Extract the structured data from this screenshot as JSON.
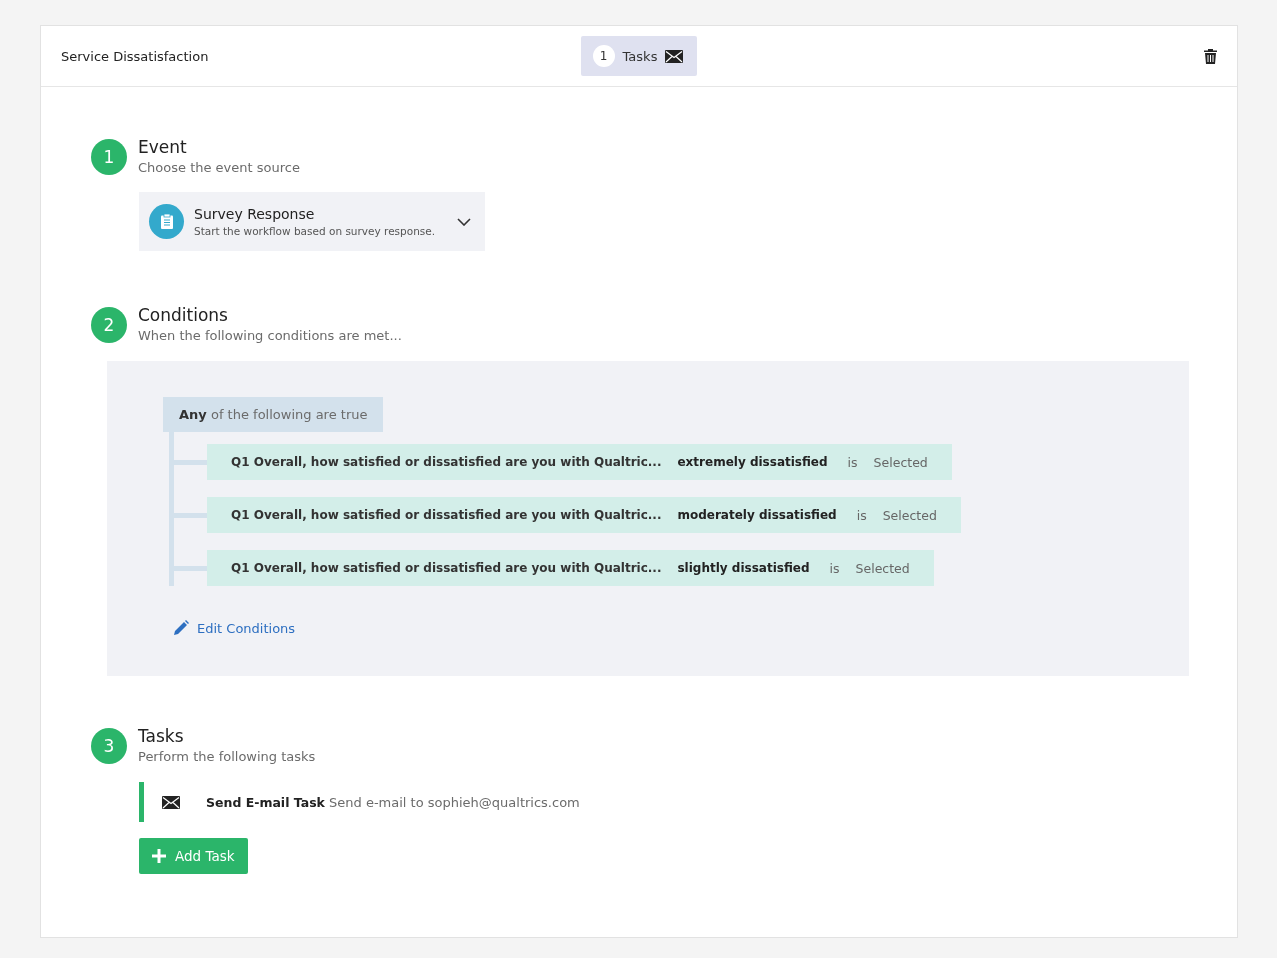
{
  "header": {
    "title": "Service Dissatisfaction",
    "tasks_badge": {
      "count": "1",
      "label": "Tasks"
    }
  },
  "event": {
    "number": "1",
    "title": "Event",
    "subtitle": "Choose the event source",
    "source": {
      "title": "Survey Response",
      "description": "Start the workflow based on survey response."
    }
  },
  "conditions": {
    "number": "2",
    "title": "Conditions",
    "subtitle": "When the following conditions are met...",
    "group_label": "**Any** of the following are true",
    "rows": [
      {
        "question": "Q1 Overall, how satisfied or dissatisfied are you with Qualtric...",
        "answer": "extremely dissatisfied",
        "operator": "is",
        "value": "Selected"
      },
      {
        "question": "Q1 Overall, how satisfied or dissatisfied are you with Qualtric...",
        "answer": "moderately dissatisfied",
        "operator": "is",
        "value": "Selected"
      },
      {
        "question": "Q1 Overall, how satisfied or dissatisfied are you with Qualtric...",
        "answer": "slightly dissatisfied",
        "operator": "is",
        "value": "Selected"
      }
    ],
    "edit_link": "Edit Conditions"
  },
  "tasks": {
    "number": "3",
    "title": "Tasks",
    "subtitle": "Perform the following tasks",
    "items": [
      {
        "name": "Send E-mail Task",
        "description": "Send e-mail to sophieh@qualtrics.com"
      }
    ],
    "add_button": "Add Task"
  }
}
